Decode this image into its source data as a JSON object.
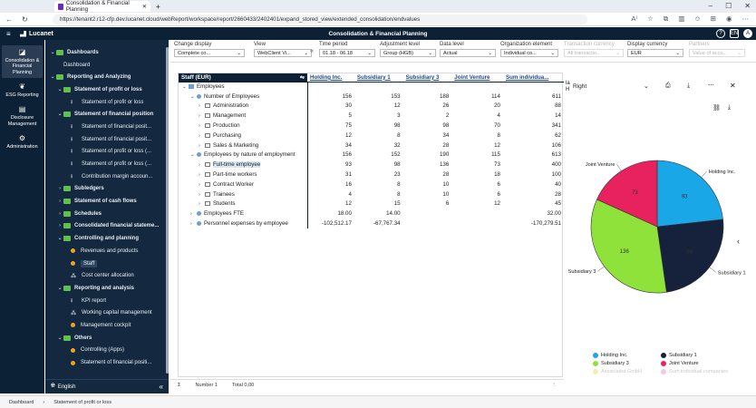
{
  "browser": {
    "tab_title": "Consolidation & Financial Planning",
    "url": "https://tenant2.r12-cfp.dev.lucanet.cloud/webReport/workspace/report/2660433/2402401/expand_stored_view/extended_consolidation/endvalues"
  },
  "app": {
    "brand": "Lucanet",
    "title": "Consolidation & Financial Planning",
    "header_icons": [
      "help-icon",
      "language-icon",
      "user-icon"
    ],
    "lang_badge": "EN",
    "user_badge": "A"
  },
  "rail": [
    {
      "label": "Consolidation & Financial Planning",
      "icon": "chart-icon",
      "active": true
    },
    {
      "label": "ESG Reporting",
      "icon": "leaf-icon"
    },
    {
      "label": "Disclosure Management",
      "icon": "doc-icon"
    },
    {
      "label": "Administration",
      "icon": "gear-icon"
    }
  ],
  "nav": [
    {
      "label": "Dashboards",
      "type": "folder",
      "level": 0,
      "chev": "⌄"
    },
    {
      "label": "Dashboard",
      "type": "plain",
      "level": 1
    },
    {
      "label": "Reporting and Analyzing",
      "type": "folder",
      "level": 0,
      "chev": "⌄"
    },
    {
      "label": "Statement of profit or loss",
      "type": "folder",
      "level": 1,
      "chev": "⌄"
    },
    {
      "label": "Statement of profit or loss",
      "type": "doc",
      "level": 2
    },
    {
      "label": "Statement of financial position",
      "type": "folder",
      "level": 1,
      "chev": "⌄"
    },
    {
      "label": "Statement of financial posit...",
      "type": "doc",
      "level": 2
    },
    {
      "label": "Statement of financial posit...",
      "type": "doc",
      "level": 2
    },
    {
      "label": "Statement of profit or loss (...",
      "type": "doc",
      "level": 2
    },
    {
      "label": "Statement of profit or loss (...",
      "type": "doc",
      "level": 2
    },
    {
      "label": "Contribution margin accoun...",
      "type": "doc",
      "level": 2
    },
    {
      "label": "Subledgers",
      "type": "folder",
      "level": 1,
      "chev": "›"
    },
    {
      "label": "Statement of cash flows",
      "type": "folder",
      "level": 1,
      "chev": "›"
    },
    {
      "label": "Schedules",
      "type": "folder",
      "level": 1,
      "chev": "›"
    },
    {
      "label": "Consolidated financial stateme...",
      "type": "folder",
      "level": 1,
      "chev": "›"
    },
    {
      "label": "Controlling and planning",
      "type": "folder",
      "level": 1,
      "chev": "⌄"
    },
    {
      "label": "Revenues and products",
      "type": "dot",
      "level": 2
    },
    {
      "label": "Staff",
      "type": "dot",
      "level": 2,
      "selected": true
    },
    {
      "label": "Cost center allocation",
      "type": "alloc",
      "level": 2
    },
    {
      "label": "Reporting and analysis",
      "type": "folder",
      "level": 1,
      "chev": "⌄"
    },
    {
      "label": "KPI report",
      "type": "doc",
      "level": 2
    },
    {
      "label": "Working capital management",
      "type": "alloc",
      "level": 2
    },
    {
      "label": "Management cockpit",
      "type": "dot",
      "level": 2
    },
    {
      "label": "Others",
      "type": "folder",
      "level": 1,
      "chev": "⌄"
    },
    {
      "label": "Controlling (Apps)",
      "type": "dot",
      "level": 2
    },
    {
      "label": "Statement of financial positi...",
      "type": "dot",
      "level": 2
    }
  ],
  "nav_footer": {
    "language": "English",
    "collapse": "«"
  },
  "toolbar": [
    {
      "caption": "Change display",
      "value": "Complete co..."
    },
    {
      "caption": "View",
      "value": "WebClient Vi..."
    },
    {
      "caption": "Time period",
      "value": "01.18 - 06.18"
    },
    {
      "caption": "Adjustment level",
      "value": "Group (HGB)"
    },
    {
      "caption": "Data level",
      "value": "Actual"
    },
    {
      "caption": "Organization element",
      "value": "Individual co..."
    },
    {
      "caption": "Transaction currency",
      "value": "All transactio...",
      "disabled": true
    },
    {
      "caption": "Display currency",
      "value": "EUR"
    },
    {
      "caption": "Partners",
      "value": "Value of acco...",
      "disabled": true
    }
  ],
  "table": {
    "corner": "Staff (EUR)",
    "columns": [
      "Holding Inc.",
      "Subsidiary 1",
      "Subsidiary 3",
      "Joint Venture",
      "Sum individua..."
    ],
    "rows": [
      {
        "label": "Employees",
        "indent": 0,
        "icon": "folder",
        "exp": "⌄",
        "vals": [
          "",
          "",
          "",
          "",
          ""
        ]
      },
      {
        "label": "Number of Employees",
        "indent": 1,
        "icon": "dot",
        "exp": "⌄",
        "vals": [
          "156",
          "153",
          "188",
          "114",
          "611"
        ]
      },
      {
        "label": "Administration",
        "indent": 2,
        "icon": "box",
        "exp": "›",
        "vals": [
          "30",
          "12",
          "26",
          "20",
          "88"
        ]
      },
      {
        "label": "Management",
        "indent": 2,
        "icon": "box",
        "exp": "›",
        "vals": [
          "5",
          "3",
          "2",
          "4",
          "14"
        ]
      },
      {
        "label": "Production",
        "indent": 2,
        "icon": "box",
        "exp": "›",
        "vals": [
          "75",
          "98",
          "98",
          "70",
          "341"
        ]
      },
      {
        "label": "Purchasing",
        "indent": 2,
        "icon": "box",
        "exp": "›",
        "vals": [
          "12",
          "8",
          "34",
          "8",
          "62"
        ]
      },
      {
        "label": "Sales & Marketing",
        "indent": 2,
        "icon": "box",
        "exp": "›",
        "vals": [
          "34",
          "32",
          "28",
          "12",
          "106"
        ]
      },
      {
        "label": "Employees by nature of employment",
        "indent": 1,
        "icon": "dot",
        "exp": "⌄",
        "vals": [
          "156",
          "152",
          "190",
          "115",
          "613"
        ]
      },
      {
        "label": "Full-time employee",
        "indent": 2,
        "icon": "box",
        "exp": "›",
        "hl": true,
        "vals": [
          "93",
          "98",
          "136",
          "73",
          "400"
        ]
      },
      {
        "label": "Part-time workers",
        "indent": 2,
        "icon": "box",
        "exp": "›",
        "vals": [
          "31",
          "23",
          "28",
          "18",
          "100"
        ]
      },
      {
        "label": "Contract Worker",
        "indent": 2,
        "icon": "box",
        "exp": "›",
        "vals": [
          "16",
          "8",
          "10",
          "6",
          "40"
        ]
      },
      {
        "label": "Trainees",
        "indent": 2,
        "icon": "box",
        "exp": "›",
        "vals": [
          "4",
          "8",
          "10",
          "6",
          "28"
        ]
      },
      {
        "label": "Students",
        "indent": 2,
        "icon": "box",
        "exp": "›",
        "vals": [
          "12",
          "15",
          "6",
          "12",
          "45"
        ]
      },
      {
        "label": "Employees FTE",
        "indent": 1,
        "icon": "dot",
        "exp": "›",
        "vals": [
          "18.00",
          "14.00",
          "",
          "",
          "32.00"
        ]
      },
      {
        "label": "Personnel expenses by employee",
        "indent": 1,
        "icon": "dot",
        "exp": "›",
        "vals": [
          "-102,512.17",
          "-67,767.34",
          "",
          "",
          "-170,279.51"
        ]
      }
    ],
    "footer": {
      "number": "Number 1",
      "total": "Total 0,00"
    }
  },
  "chart_panel": {
    "position_label": "Right",
    "side_text": "la\nH",
    "collapse_arrow": "‹"
  },
  "chart_data": {
    "type": "pie",
    "slices": [
      {
        "name": "Holding Inc.",
        "value": 93,
        "color": "#1aa7e8"
      },
      {
        "name": "Subsidiary 1",
        "value": 98,
        "color": "#16213b"
      },
      {
        "name": "Subsidiary 3",
        "value": 136,
        "color": "#8fe23a"
      },
      {
        "name": "Joint Venture",
        "value": 73,
        "color": "#e8225e"
      }
    ],
    "legend": [
      {
        "name": "Holding Inc.",
        "color": "#1aa7e8"
      },
      {
        "name": "Subsidiary 1",
        "color": "#16213b"
      },
      {
        "name": "Subsidiary 3",
        "color": "#8fe23a"
      },
      {
        "name": "Joint Venture",
        "color": "#e8225e"
      },
      {
        "name": "Associated GmbH",
        "color": "#f3efb4",
        "faded": true
      },
      {
        "name": "Sum individual companies",
        "color": "#f3c8e2",
        "faded": true
      }
    ],
    "legend_position": "bottom"
  },
  "statusbar": {
    "crumbs": [
      "Dashboard",
      "Statement of profit or loss"
    ]
  }
}
